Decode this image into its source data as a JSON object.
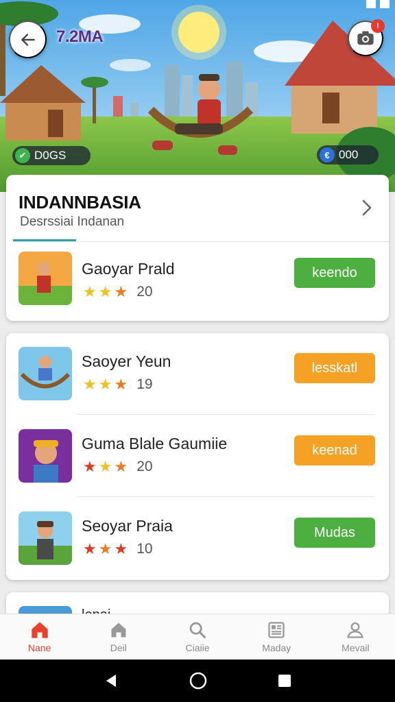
{
  "header": {
    "version_label": "7.2MA",
    "camera_badge": "!",
    "left_pill": {
      "icon": "ticket-icon",
      "glyph": "✔",
      "value": "D0GS"
    },
    "right_pill": {
      "icon": "coin-icon",
      "glyph": "€",
      "value": "000"
    }
  },
  "section": {
    "title": "INDANNBASIA",
    "subtitle": "Desrssiai Indanan"
  },
  "games": [
    {
      "name": "Gaoyar Prald",
      "rating": "20",
      "button": "keendo",
      "button_color": "#4caf3f",
      "stars": [
        "#f0c020",
        "#f0c020",
        "#f07a20"
      ]
    },
    {
      "name": "Saoyer Yeun",
      "rating": "19",
      "button": "lesskatl",
      "button_color": "#f5a124",
      "stars": [
        "#f0c020",
        "#f0c020",
        "#f07a20"
      ]
    },
    {
      "name": "Guma Blale Gaumiie",
      "rating": "20",
      "button": "keenad",
      "button_color": "#f5a124",
      "stars": [
        "#e23a22",
        "#f0c020",
        "#f07a20"
      ]
    },
    {
      "name": "Seoyar Praia",
      "rating": "10",
      "button": "Mudas",
      "button_color": "#4caf3f",
      "stars": [
        "#e23a22",
        "#f07a20",
        "#e23a22"
      ]
    }
  ],
  "partial_row": {
    "name": "lenai"
  },
  "bottom_nav": [
    {
      "label": "Nane",
      "icon": "home-icon",
      "active": true
    },
    {
      "label": "Deil",
      "icon": "house-icon",
      "active": false
    },
    {
      "label": "Ciaiie",
      "icon": "search-icon",
      "active": false
    },
    {
      "label": "Maday",
      "icon": "news-icon",
      "active": false
    },
    {
      "label": "Mevail",
      "icon": "profile-icon",
      "active": false
    }
  ],
  "colors": {
    "accent": "#e8402e",
    "tab_indicator": "#2aa6a0",
    "green_button": "#4caf3f",
    "orange_button": "#f5a124"
  }
}
